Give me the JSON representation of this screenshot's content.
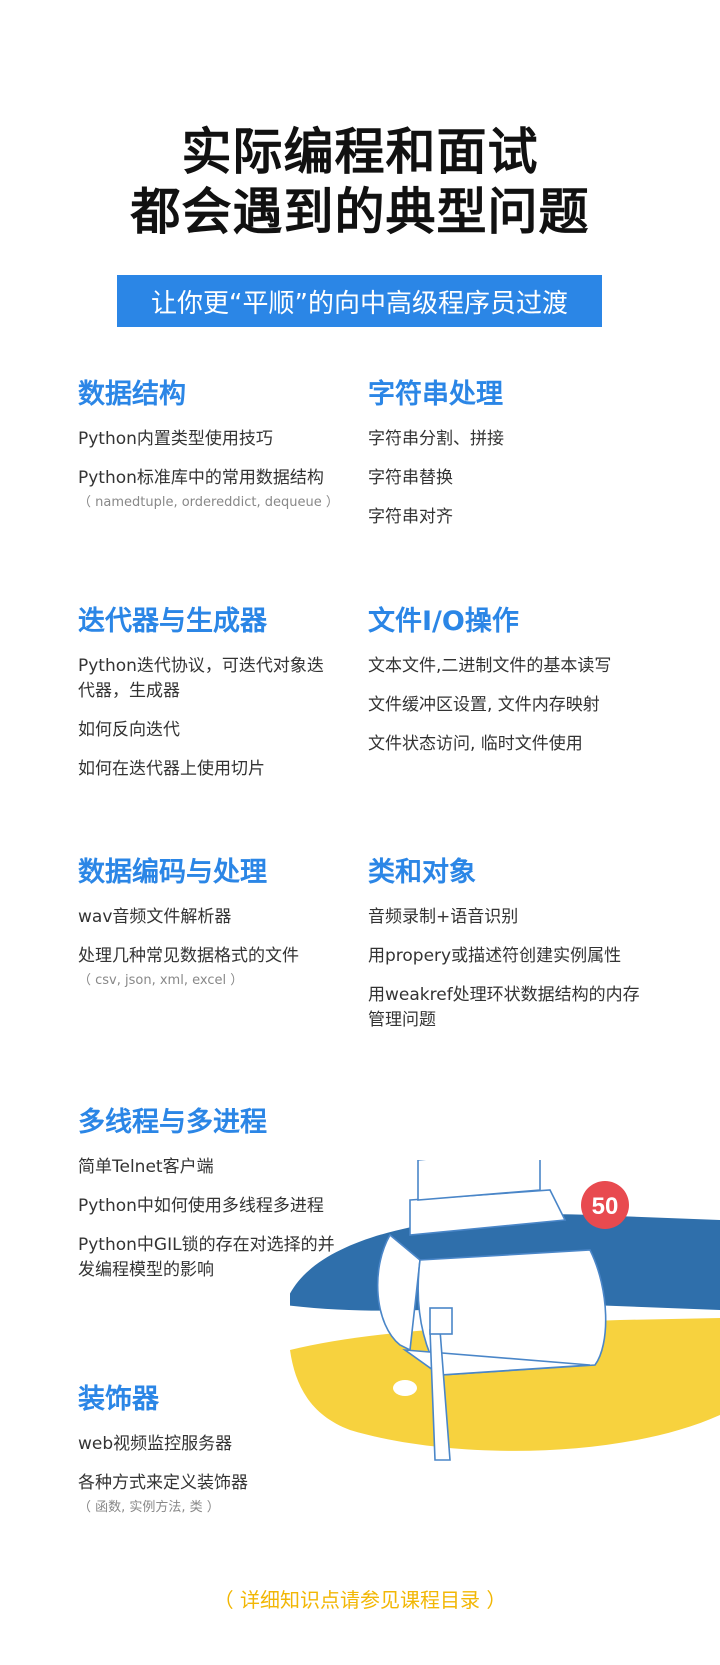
{
  "header": {
    "title_line1": "实际编程和面试",
    "title_line2": "都会遇到的典型问题",
    "banner": "让你更“平顺”的向中高级程序员过渡"
  },
  "sections": [
    {
      "title": "数据结构",
      "items": [
        {
          "text": "Python内置类型使用技巧"
        },
        {
          "text": "Python标准库中的常用数据结构",
          "sub": "（ namedtuple, ordereddict, dequeue ）"
        }
      ]
    },
    {
      "title": "字符串处理",
      "items": [
        {
          "text": "字符串分割、拼接"
        },
        {
          "text": "字符串替换"
        },
        {
          "text": "字符串对齐"
        }
      ]
    },
    {
      "title": "迭代器与生成器",
      "items": [
        {
          "text": "Python迭代协议，可迭代对象迭代器，生成器"
        },
        {
          "text": "如何反向迭代"
        },
        {
          "text": "如何在迭代器上使用切片"
        }
      ]
    },
    {
      "title": "文件I/O操作",
      "items": [
        {
          "text": "文本文件,二进制文件的基本读写"
        },
        {
          "text": "文件缓冲区设置, 文件内存映射"
        },
        {
          "text": "文件状态访问, 临时文件使用"
        }
      ]
    },
    {
      "title": "数据编码与处理",
      "items": [
        {
          "text": "wav音频文件解析器"
        },
        {
          "text": "处理几种常见数据格式的文件",
          "sub": "（ csv, json, xml, excel ）"
        }
      ]
    },
    {
      "title": "类和对象",
      "items": [
        {
          "text": "音频录制+语音识别"
        },
        {
          "text": "用propery或描述符创建实例属性"
        },
        {
          "text": "用weakref处理环状数据结构的内存管理问题"
        }
      ]
    },
    {
      "title": "多线程与多进程",
      "items": [
        {
          "text": "简单Telnet客户端"
        },
        {
          "text": "Python中如何使用多线程多进程"
        },
        {
          "text": "Python中GIL锁的存在对选择的并发编程模型的影响"
        }
      ]
    },
    {
      "title": "装饰器",
      "items": [
        {
          "text": "web视频监控服务器"
        },
        {
          "text": "各种方式来定义装饰器",
          "sub": "（ 函数, 实例方法, 类 ）"
        }
      ]
    }
  ],
  "badge": "50",
  "footer": "（ 详细知识点请参见课程目录 ）",
  "colors": {
    "accent": "#2b86e6",
    "footer": "#f2b705",
    "badge": "#e84a4f",
    "python_blue": "#2f6fab",
    "python_yellow": "#f7d23e"
  },
  "icons": [
    "python-logo-illustration",
    "box-illustration"
  ]
}
